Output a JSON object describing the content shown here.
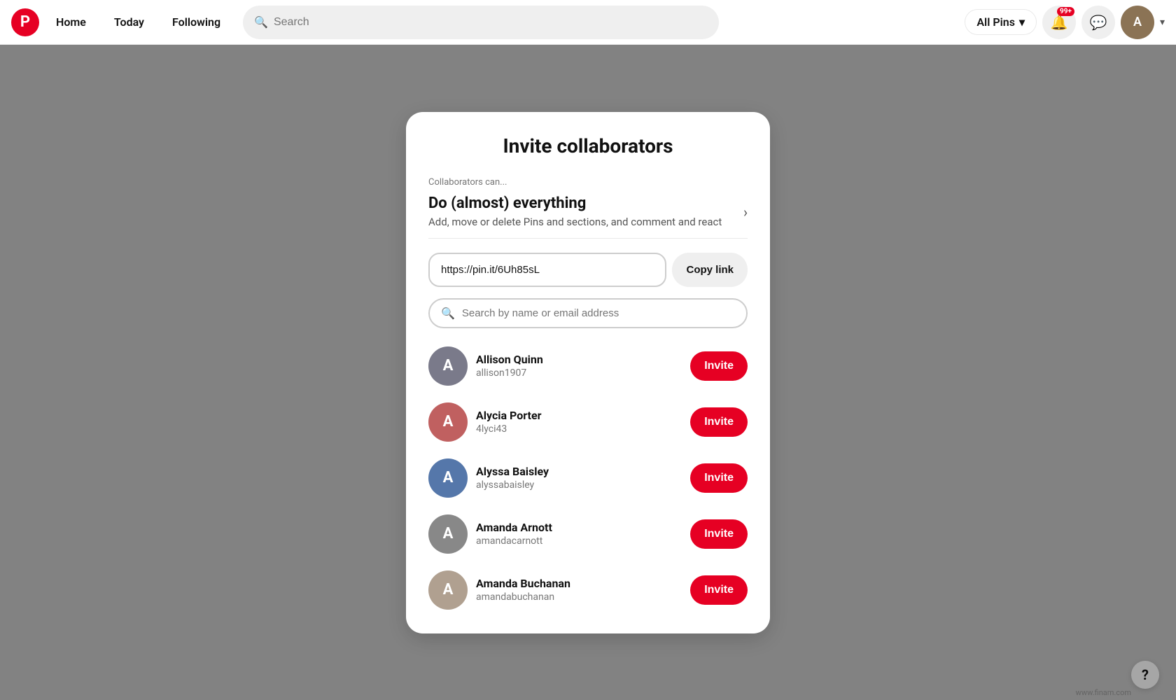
{
  "nav": {
    "logo_char": "P",
    "links": [
      "Home",
      "Today",
      "Following"
    ],
    "search_placeholder": "Search",
    "allpins_label": "All Pins",
    "badge": "99+",
    "avatar_char": "A"
  },
  "modal": {
    "title": "Invite collaborators",
    "collab_label": "Collaborators can...",
    "permission_title": "Do (almost) everything",
    "permission_desc": "Add, move or delete Pins and sections, and comment and react",
    "link_value": "https://pin.it/6Uh85sL",
    "copy_link_label": "Copy link",
    "search_placeholder": "Search by name or email address"
  },
  "users": [
    {
      "name": "Allison Quinn",
      "handle": "allison1907",
      "avatar_char": "A",
      "av_class": "av1"
    },
    {
      "name": "Alycia Porter",
      "handle": "4lyci43",
      "avatar_char": "A",
      "av_class": "av2"
    },
    {
      "name": "Alyssa Baisley",
      "handle": "alyssabaisley",
      "avatar_char": "A",
      "av_class": "av3"
    },
    {
      "name": "Amanda Arnott",
      "handle": "amandacarnott",
      "avatar_char": "A",
      "av_class": "av4"
    },
    {
      "name": "Amanda Buchanan",
      "handle": "amandabuchanan",
      "avatar_char": "A",
      "av_class": "av5"
    }
  ],
  "invite_label": "Invite",
  "help_char": "?"
}
